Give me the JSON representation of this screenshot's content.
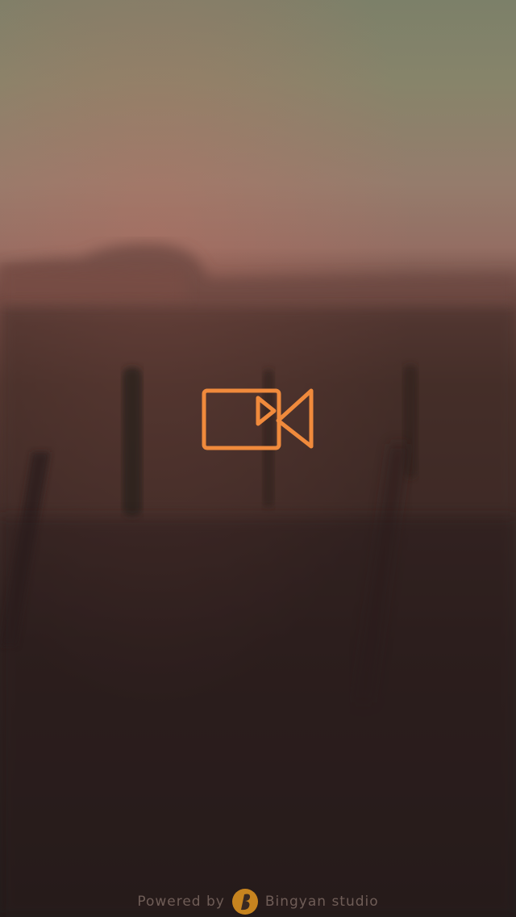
{
  "splash": {
    "powered_by": "Powered by",
    "studio_name": "Bingyan studio",
    "center_icon": "video-camera-icon",
    "logo_icon": "bingyan-logo-icon",
    "accent_color": "#f08a3c",
    "footer_text_color": "#6f5d57"
  }
}
